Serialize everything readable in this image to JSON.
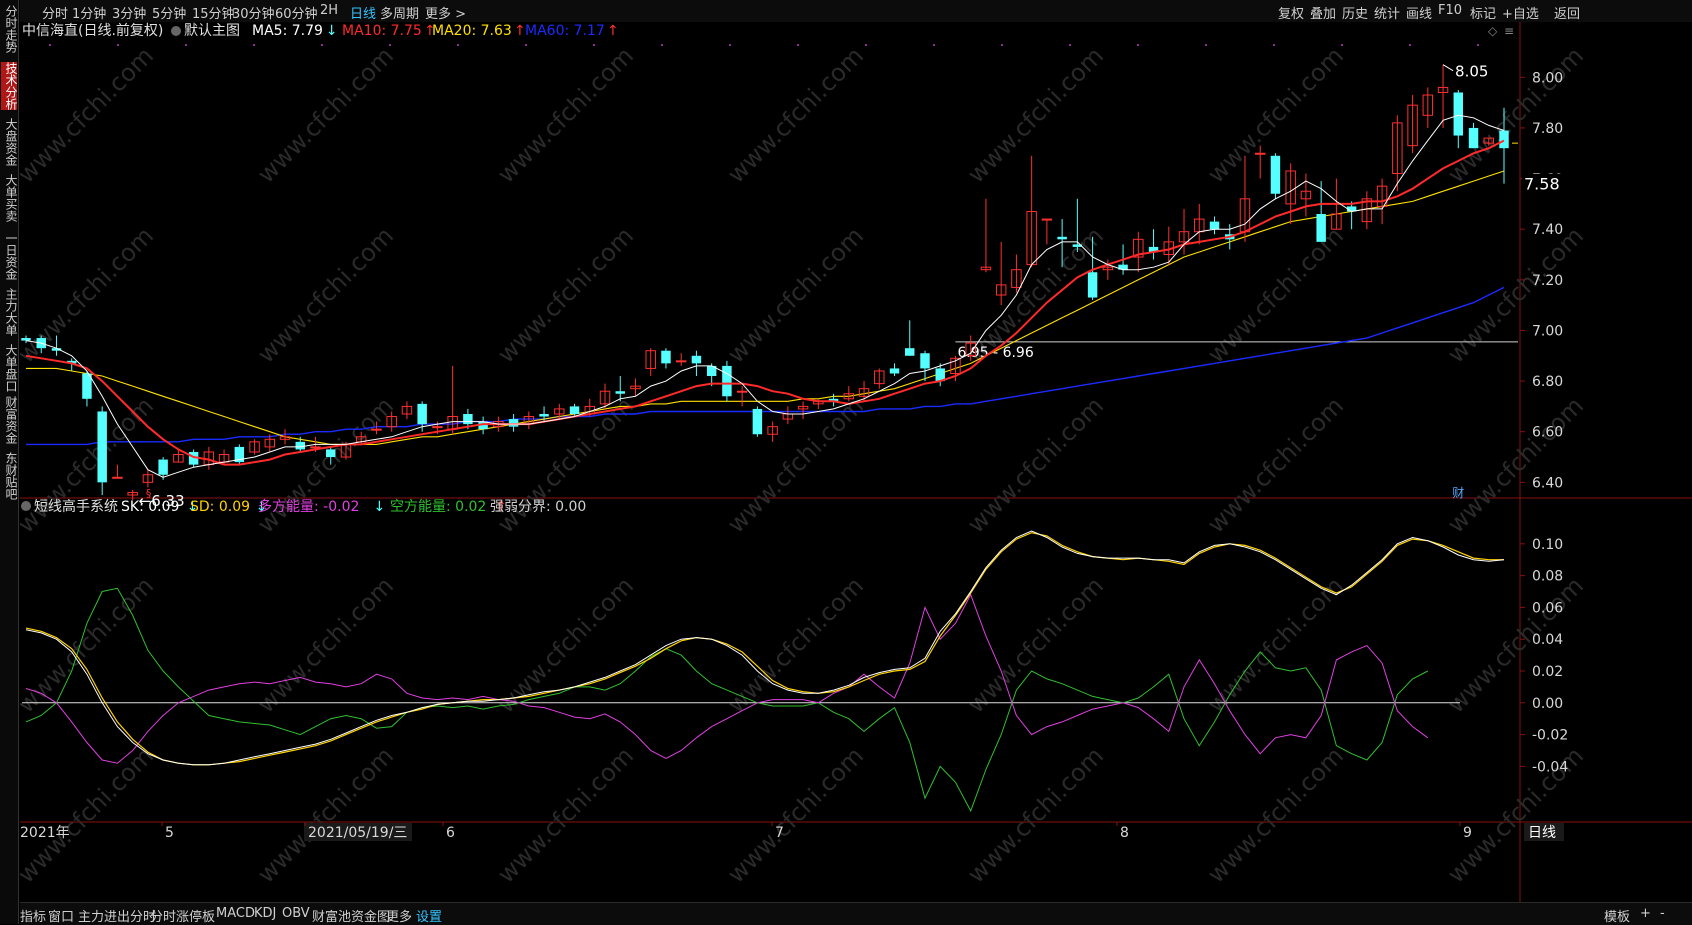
{
  "left_tabs": [
    "分时走势",
    "技术分析",
    "大盘资金",
    "大单买卖",
    "一日资金",
    "主力大单",
    "大单盘口",
    "财富资金",
    "东财贴吧"
  ],
  "left_active": 1,
  "periods": [
    "分时",
    "1分钟",
    "3分钟",
    "5分钟",
    "15分钟",
    "30分钟",
    "60分钟",
    "2H",
    "日线",
    "多周期",
    "更多 >"
  ],
  "period_active": 8,
  "right_tools": [
    "复权",
    "叠加",
    "历史",
    "统计",
    "画线",
    "F10",
    "标记",
    "+自选",
    "返回"
  ],
  "main": {
    "stock": "中信海直(日线.前复权)",
    "chart_name": "默认主图",
    "ma": [
      {
        "label": "MA5: 7.79",
        "arrow": "↓",
        "color": "#ffffff"
      },
      {
        "label": "MA10: 7.75",
        "arrow": "↑",
        "color": "#ff2a2a"
      },
      {
        "label": "MA20: 7.63",
        "arrow": "↑",
        "color": "#ffe000"
      },
      {
        "label": "MA60: 7.17",
        "arrow": "↑",
        "color": "#1a2bff"
      }
    ],
    "yticks": [
      "8.00",
      "7.80",
      "7.60",
      "7.40",
      "7.20",
      "7.00",
      "6.80",
      "6.60",
      "6.40"
    ],
    "last_price": "7.58",
    "high_label": "8.05",
    "low_label": "←6.33",
    "range_label": "6.95 - 6.96",
    "cai_mark": "财",
    "s_mark": "§"
  },
  "sub": {
    "name": "短线高手系统",
    "items": [
      {
        "label": "SK: 0.09",
        "arrow": "↓",
        "color": "#ffffff"
      },
      {
        "label": "SD: 0.09",
        "arrow": "↓",
        "color": "#ffd200"
      },
      {
        "label": "多方能量: -0.02",
        "arrow": "↓",
        "color": "#e040e0"
      },
      {
        "label": "空方能量: 0.02",
        "arrow": "↑",
        "color": "#30c030"
      },
      {
        "label": "强弱分界: 0.00",
        "arrow": "",
        "color": "#d0d0d0"
      }
    ],
    "yticks": [
      "0.10",
      "0.08",
      "0.06",
      "0.04",
      "0.02",
      "0.00",
      "-0.02",
      "-0.04"
    ]
  },
  "xaxis": [
    "2021年",
    "5",
    "2021/05/19/三",
    "6",
    "7",
    "8",
    "9"
  ],
  "period_label": "日线",
  "bottom_tabs": [
    "指标",
    "窗口",
    "主力进出分时",
    "分时涨停板",
    "MACD",
    "KDJ",
    "OBV",
    "财富池资金图",
    "更多",
    "设置"
  ],
  "bottom_active": 9,
  "bottom_right": [
    "模板",
    "+",
    "-"
  ],
  "watermark": "www.cfchi.com",
  "colors": {
    "up": "#ff3030",
    "down": "#55ffff",
    "grid": "#3a0000",
    "axis": "#8a1010"
  },
  "chart_data": {
    "type": "candlestick",
    "candles": [
      [
        6.97,
        6.96,
        6.98,
        6.95
      ],
      [
        6.97,
        6.93,
        6.98,
        6.91
      ],
      [
        6.93,
        6.92,
        6.98,
        6.9
      ],
      [
        6.88,
        6.87,
        6.89,
        6.84
      ],
      [
        6.83,
        6.73,
        6.84,
        6.7
      ],
      [
        6.68,
        6.4,
        6.7,
        6.35
      ],
      [
        6.42,
        6.42,
        6.47,
        6.42
      ],
      [
        6.35,
        6.36,
        6.37,
        6.33
      ],
      [
        6.4,
        6.43,
        6.45,
        6.38
      ],
      [
        6.49,
        6.43,
        6.5,
        6.41
      ],
      [
        6.48,
        6.51,
        6.53,
        6.48
      ],
      [
        6.52,
        6.47,
        6.53,
        6.46
      ],
      [
        6.47,
        6.52,
        6.54,
        6.45
      ],
      [
        6.48,
        6.51,
        6.53,
        6.47
      ],
      [
        6.54,
        6.48,
        6.55,
        6.47
      ],
      [
        6.52,
        6.56,
        6.57,
        6.51
      ],
      [
        6.54,
        6.57,
        6.59,
        6.52
      ],
      [
        6.57,
        6.58,
        6.61,
        6.55
      ],
      [
        6.56,
        6.53,
        6.58,
        6.52
      ],
      [
        6.54,
        6.54,
        6.58,
        6.52
      ],
      [
        6.53,
        6.5,
        6.54,
        6.47
      ],
      [
        6.5,
        6.55,
        6.56,
        6.49
      ],
      [
        6.56,
        6.58,
        6.6,
        6.55
      ],
      [
        6.61,
        6.61,
        6.64,
        6.59
      ],
      [
        6.62,
        6.66,
        6.68,
        6.6
      ],
      [
        6.67,
        6.7,
        6.72,
        6.65
      ],
      [
        6.71,
        6.63,
        6.72,
        6.6
      ],
      [
        6.62,
        6.62,
        6.64,
        6.59
      ],
      [
        6.61,
        6.66,
        6.86,
        6.59
      ],
      [
        6.67,
        6.63,
        6.69,
        6.61
      ],
      [
        6.64,
        6.61,
        6.66,
        6.59
      ],
      [
        6.62,
        6.64,
        6.66,
        6.6
      ],
      [
        6.65,
        6.62,
        6.67,
        6.6
      ],
      [
        6.63,
        6.66,
        6.68,
        6.61
      ],
      [
        6.67,
        6.66,
        6.7,
        6.64
      ],
      [
        6.67,
        6.69,
        6.71,
        6.65
      ],
      [
        6.7,
        6.67,
        6.71,
        6.66
      ],
      [
        6.67,
        6.7,
        6.73,
        6.66
      ],
      [
        6.71,
        6.76,
        6.79,
        6.69
      ],
      [
        6.76,
        6.75,
        6.82,
        6.72
      ],
      [
        6.77,
        6.78,
        6.81,
        6.74
      ],
      [
        6.85,
        6.92,
        6.93,
        6.82
      ],
      [
        6.92,
        6.87,
        6.93,
        6.85
      ],
      [
        6.88,
        6.88,
        6.91,
        6.86
      ],
      [
        6.9,
        6.87,
        6.92,
        6.82
      ],
      [
        6.86,
        6.82,
        6.87,
        6.78
      ],
      [
        6.86,
        6.74,
        6.88,
        6.72
      ],
      [
        6.76,
        6.76,
        6.78,
        6.7
      ],
      [
        6.69,
        6.59,
        6.7,
        6.58
      ],
      [
        6.59,
        6.62,
        6.64,
        6.56
      ],
      [
        6.65,
        6.67,
        6.7,
        6.63
      ],
      [
        6.69,
        6.7,
        6.72,
        6.65
      ],
      [
        6.71,
        6.72,
        6.73,
        6.69
      ],
      [
        6.73,
        6.72,
        6.75,
        6.7
      ],
      [
        6.73,
        6.75,
        6.78,
        6.72
      ],
      [
        6.74,
        6.77,
        6.8,
        6.72
      ],
      [
        6.79,
        6.84,
        6.85,
        6.77
      ],
      [
        6.85,
        6.83,
        6.87,
        6.82
      ],
      [
        6.93,
        6.9,
        7.04,
        6.9
      ],
      [
        6.91,
        6.85,
        6.92,
        6.8
      ],
      [
        6.85,
        6.8,
        6.87,
        6.78
      ],
      [
        6.83,
        6.89,
        6.9,
        6.8
      ],
      [
        6.9,
        6.95,
        6.98,
        6.88
      ],
      [
        7.24,
        7.25,
        7.52,
        7.23
      ],
      [
        7.14,
        7.18,
        7.35,
        7.1
      ],
      [
        7.17,
        7.24,
        7.3,
        7.15
      ],
      [
        7.26,
        7.47,
        7.69,
        7.25
      ],
      [
        7.44,
        7.44,
        7.44,
        7.34
      ],
      [
        7.37,
        7.36,
        7.44,
        7.25
      ],
      [
        7.34,
        7.33,
        7.52,
        7.31
      ],
      [
        7.23,
        7.13,
        7.37,
        7.12
      ],
      [
        7.24,
        7.25,
        7.28,
        7.2
      ],
      [
        7.26,
        7.24,
        7.34,
        7.22
      ],
      [
        7.29,
        7.36,
        7.39,
        7.23
      ],
      [
        7.33,
        7.31,
        7.4,
        7.28
      ],
      [
        7.3,
        7.35,
        7.41,
        7.26
      ],
      [
        7.35,
        7.39,
        7.48,
        7.3
      ],
      [
        7.39,
        7.44,
        7.5,
        7.34
      ],
      [
        7.43,
        7.4,
        7.45,
        7.38
      ],
      [
        7.38,
        7.36,
        7.42,
        7.32
      ],
      [
        7.39,
        7.52,
        7.69,
        7.35
      ],
      [
        7.7,
        7.7,
        7.73,
        7.6
      ],
      [
        7.69,
        7.54,
        7.7,
        7.52
      ],
      [
        7.5,
        7.63,
        7.66,
        7.42
      ],
      [
        7.52,
        7.55,
        7.62,
        7.45
      ],
      [
        7.46,
        7.35,
        7.59,
        7.35
      ],
      [
        7.4,
        7.46,
        7.6,
        7.4
      ],
      [
        7.49,
        7.47,
        7.51,
        7.4
      ],
      [
        7.43,
        7.52,
        7.55,
        7.4
      ],
      [
        7.49,
        7.57,
        7.6,
        7.42
      ],
      [
        7.62,
        7.82,
        7.85,
        7.55
      ],
      [
        7.73,
        7.89,
        7.93,
        7.7
      ],
      [
        7.85,
        7.93,
        7.96,
        7.8
      ],
      [
        7.94,
        7.96,
        8.05,
        7.8
      ],
      [
        7.94,
        7.77,
        7.95,
        7.72
      ],
      [
        7.8,
        7.72,
        7.82,
        7.72
      ],
      [
        7.74,
        7.76,
        7.76,
        7.73
      ],
      [
        7.79,
        7.72,
        7.88,
        7.58
      ]
    ],
    "ma5": [
      6.96,
      6.95,
      6.93,
      6.9,
      6.84,
      6.74,
      6.63,
      6.54,
      6.45,
      6.42,
      6.44,
      6.46,
      6.47,
      6.48,
      6.49,
      6.5,
      6.52,
      6.54,
      6.54,
      6.55,
      6.55,
      6.55,
      6.56,
      6.57,
      6.58,
      6.6,
      6.62,
      6.63,
      6.64,
      6.64,
      6.64,
      6.63,
      6.63,
      6.63,
      6.64,
      6.65,
      6.66,
      6.68,
      6.7,
      6.73,
      6.74,
      6.78,
      6.8,
      6.84,
      6.86,
      6.86,
      6.83,
      6.79,
      6.72,
      6.68,
      6.67,
      6.67,
      6.68,
      6.69,
      6.71,
      6.73,
      6.76,
      6.79,
      6.83,
      6.84,
      6.86,
      6.88,
      6.91,
      7.0,
      7.06,
      7.14,
      7.26,
      7.32,
      7.35,
      7.35,
      7.29,
      7.26,
      7.24,
      7.24,
      7.25,
      7.27,
      7.34,
      7.39,
      7.4,
      7.4,
      7.42,
      7.48,
      7.52,
      7.55,
      7.59,
      7.56,
      7.51,
      7.47,
      7.48,
      7.48,
      7.58,
      7.67,
      7.75,
      7.83,
      7.85,
      7.84,
      7.81,
      7.79
    ],
    "ma10": [
      6.9,
      6.89,
      6.88,
      6.87,
      6.85,
      6.8,
      6.74,
      6.68,
      6.62,
      6.57,
      6.53,
      6.5,
      6.49,
      6.47,
      6.47,
      6.48,
      6.49,
      6.51,
      6.52,
      6.53,
      6.54,
      6.55,
      6.55,
      6.56,
      6.57,
      6.58,
      6.59,
      6.6,
      6.61,
      6.62,
      6.63,
      6.63,
      6.63,
      6.63,
      6.64,
      6.65,
      6.66,
      6.67,
      6.68,
      6.69,
      6.7,
      6.72,
      6.74,
      6.76,
      6.78,
      6.79,
      6.79,
      6.79,
      6.78,
      6.76,
      6.75,
      6.73,
      6.72,
      6.72,
      6.71,
      6.72,
      6.73,
      6.75,
      6.77,
      6.79,
      6.8,
      6.82,
      6.85,
      6.9,
      6.94,
      6.99,
      7.05,
      7.11,
      7.16,
      7.21,
      7.24,
      7.26,
      7.28,
      7.3,
      7.31,
      7.32,
      7.34,
      7.35,
      7.36,
      7.37,
      7.39,
      7.42,
      7.45,
      7.47,
      7.49,
      7.5,
      7.5,
      7.5,
      7.51,
      7.51,
      7.53,
      7.56,
      7.6,
      7.64,
      7.67,
      7.7,
      7.72,
      7.75
    ],
    "ma20": [
      6.85,
      6.85,
      6.85,
      6.84,
      6.83,
      6.82,
      6.8,
      6.78,
      6.76,
      6.74,
      6.72,
      6.7,
      6.68,
      6.66,
      6.64,
      6.62,
      6.6,
      6.58,
      6.57,
      6.56,
      6.55,
      6.55,
      6.55,
      6.55,
      6.56,
      6.57,
      6.58,
      6.58,
      6.59,
      6.6,
      6.61,
      6.62,
      6.63,
      6.64,
      6.65,
      6.66,
      6.67,
      6.68,
      6.69,
      6.7,
      6.7,
      6.71,
      6.71,
      6.72,
      6.72,
      6.72,
      6.72,
      6.72,
      6.72,
      6.72,
      6.72,
      6.73,
      6.73,
      6.74,
      6.74,
      6.75,
      6.76,
      6.77,
      6.79,
      6.81,
      6.83,
      6.85,
      6.87,
      6.9,
      6.93,
      6.96,
      6.99,
      7.02,
      7.05,
      7.08,
      7.11,
      7.14,
      7.17,
      7.2,
      7.23,
      7.26,
      7.29,
      7.31,
      7.33,
      7.35,
      7.37,
      7.39,
      7.41,
      7.43,
      7.44,
      7.45,
      7.46,
      7.47,
      7.48,
      7.49,
      7.5,
      7.51,
      7.53,
      7.55,
      7.57,
      7.59,
      7.61,
      7.63
    ],
    "ma60": [
      6.55,
      6.55,
      6.55,
      6.55,
      6.55,
      6.56,
      6.56,
      6.56,
      6.56,
      6.56,
      6.56,
      6.57,
      6.57,
      6.57,
      6.58,
      6.58,
      6.58,
      6.59,
      6.59,
      6.6,
      6.6,
      6.61,
      6.61,
      6.62,
      6.62,
      6.62,
      6.63,
      6.63,
      6.63,
      6.64,
      6.64,
      6.64,
      6.65,
      6.65,
      6.65,
      6.66,
      6.66,
      6.66,
      6.67,
      6.67,
      6.67,
      6.68,
      6.68,
      6.68,
      6.68,
      6.68,
      6.68,
      6.68,
      6.68,
      6.68,
      6.68,
      6.68,
      6.68,
      6.68,
      6.68,
      6.68,
      6.69,
      6.69,
      6.69,
      6.7,
      6.7,
      6.71,
      6.71,
      6.72,
      6.73,
      6.74,
      6.75,
      6.76,
      6.77,
      6.78,
      6.79,
      6.8,
      6.81,
      6.82,
      6.83,
      6.84,
      6.85,
      6.86,
      6.87,
      6.88,
      6.89,
      6.9,
      6.91,
      6.92,
      6.93,
      6.94,
      6.95,
      6.96,
      6.97,
      6.99,
      7.01,
      7.03,
      7.05,
      7.07,
      7.09,
      7.11,
      7.14,
      7.17
    ],
    "sk": [
      0.046,
      0.044,
      0.04,
      0.032,
      0.018,
      0.0,
      -0.015,
      -0.025,
      -0.032,
      -0.036,
      -0.038,
      -0.039,
      -0.039,
      -0.038,
      -0.036,
      -0.034,
      -0.032,
      -0.03,
      -0.028,
      -0.026,
      -0.023,
      -0.019,
      -0.015,
      -0.011,
      -0.008,
      -0.006,
      -0.003,
      -0.001,
      0.0,
      0.001,
      0.001,
      0.002,
      0.003,
      0.005,
      0.007,
      0.008,
      0.01,
      0.013,
      0.016,
      0.02,
      0.024,
      0.03,
      0.036,
      0.04,
      0.041,
      0.04,
      0.036,
      0.03,
      0.02,
      0.012,
      0.008,
      0.006,
      0.006,
      0.008,
      0.011,
      0.016,
      0.019,
      0.021,
      0.022,
      0.028,
      0.045,
      0.056,
      0.07,
      0.085,
      0.096,
      0.104,
      0.108,
      0.104,
      0.098,
      0.094,
      0.092,
      0.091,
      0.091,
      0.091,
      0.09,
      0.09,
      0.088,
      0.095,
      0.099,
      0.1,
      0.098,
      0.095,
      0.09,
      0.084,
      0.078,
      0.072,
      0.068,
      0.074,
      0.082,
      0.09,
      0.1,
      0.104,
      0.102,
      0.098,
      0.093,
      0.09,
      0.089,
      0.09
    ],
    "sd": [
      0.047,
      0.045,
      0.041,
      0.034,
      0.021,
      0.003,
      -0.012,
      -0.023,
      -0.031,
      -0.036,
      -0.038,
      -0.039,
      -0.039,
      -0.038,
      -0.037,
      -0.035,
      -0.033,
      -0.031,
      -0.029,
      -0.027,
      -0.024,
      -0.02,
      -0.016,
      -0.012,
      -0.009,
      -0.006,
      -0.004,
      -0.001,
      0.0,
      0.001,
      0.002,
      0.002,
      0.003,
      0.004,
      0.006,
      0.008,
      0.01,
      0.012,
      0.015,
      0.019,
      0.023,
      0.028,
      0.034,
      0.039,
      0.041,
      0.04,
      0.037,
      0.032,
      0.023,
      0.014,
      0.009,
      0.007,
      0.006,
      0.007,
      0.01,
      0.014,
      0.018,
      0.02,
      0.021,
      0.026,
      0.042,
      0.055,
      0.069,
      0.084,
      0.095,
      0.103,
      0.107,
      0.105,
      0.099,
      0.095,
      0.092,
      0.091,
      0.09,
      0.091,
      0.09,
      0.089,
      0.087,
      0.094,
      0.098,
      0.1,
      0.099,
      0.096,
      0.091,
      0.085,
      0.079,
      0.073,
      0.069,
      0.073,
      0.081,
      0.089,
      0.099,
      0.103,
      0.102,
      0.099,
      0.095,
      0.091,
      0.09,
      0.09
    ],
    "duo": [
      0.009,
      0.006,
      0.0,
      -0.012,
      -0.025,
      -0.036,
      -0.038,
      -0.03,
      -0.018,
      -0.008,
      0.0,
      0.004,
      0.008,
      0.01,
      0.012,
      0.013,
      0.012,
      0.014,
      0.016,
      0.013,
      0.012,
      0.01,
      0.012,
      0.018,
      0.015,
      0.006,
      0.003,
      0.002,
      0.003,
      0.002,
      0.004,
      0.002,
      0.001,
      -0.002,
      -0.003,
      -0.006,
      -0.009,
      -0.01,
      -0.007,
      -0.012,
      -0.02,
      -0.03,
      -0.035,
      -0.03,
      -0.022,
      -0.015,
      -0.01,
      -0.005,
      0.0,
      0.002,
      0.002,
      0.002,
      0.0,
      0.006,
      0.01,
      0.018,
      0.01,
      0.003,
      0.025,
      0.06,
      0.04,
      0.05,
      0.068,
      0.042,
      0.02,
      -0.008,
      -0.02,
      -0.015,
      -0.012,
      -0.008,
      -0.004,
      -0.002,
      0.0,
      -0.003,
      -0.01,
      -0.018,
      0.01,
      0.027,
      0.012,
      -0.005,
      -0.02,
      -0.032,
      -0.022,
      -0.02,
      -0.022,
      -0.008,
      0.027,
      0.032,
      0.036,
      0.025,
      -0.005,
      -0.015,
      -0.022
    ],
    "kong": [
      -0.012,
      -0.008,
      0.0,
      0.02,
      0.05,
      0.07,
      0.072,
      0.055,
      0.033,
      0.02,
      0.01,
      0.001,
      -0.008,
      -0.01,
      -0.012,
      -0.013,
      -0.014,
      -0.017,
      -0.02,
      -0.015,
      -0.01,
      -0.008,
      -0.01,
      -0.016,
      -0.015,
      -0.006,
      -0.003,
      -0.002,
      -0.003,
      -0.002,
      -0.004,
      -0.002,
      -0.001,
      0.002,
      0.004,
      0.006,
      0.01,
      0.01,
      0.008,
      0.012,
      0.02,
      0.029,
      0.034,
      0.03,
      0.02,
      0.012,
      0.008,
      0.004,
      0.0,
      -0.002,
      -0.002,
      -0.002,
      0.0,
      -0.006,
      -0.01,
      -0.018,
      -0.01,
      -0.003,
      -0.025,
      -0.06,
      -0.04,
      -0.05,
      -0.068,
      -0.042,
      -0.02,
      0.008,
      0.02,
      0.015,
      0.012,
      0.008,
      0.004,
      0.002,
      0.0,
      0.003,
      0.01,
      0.018,
      -0.01,
      -0.027,
      -0.012,
      0.005,
      0.02,
      0.032,
      0.022,
      0.02,
      0.022,
      0.008,
      -0.027,
      -0.032,
      -0.036,
      -0.025,
      0.005,
      0.015,
      0.02
    ],
    "main_ylim": [
      6.35,
      8.1
    ],
    "sub_ylim": [
      -0.075,
      0.115
    ]
  }
}
